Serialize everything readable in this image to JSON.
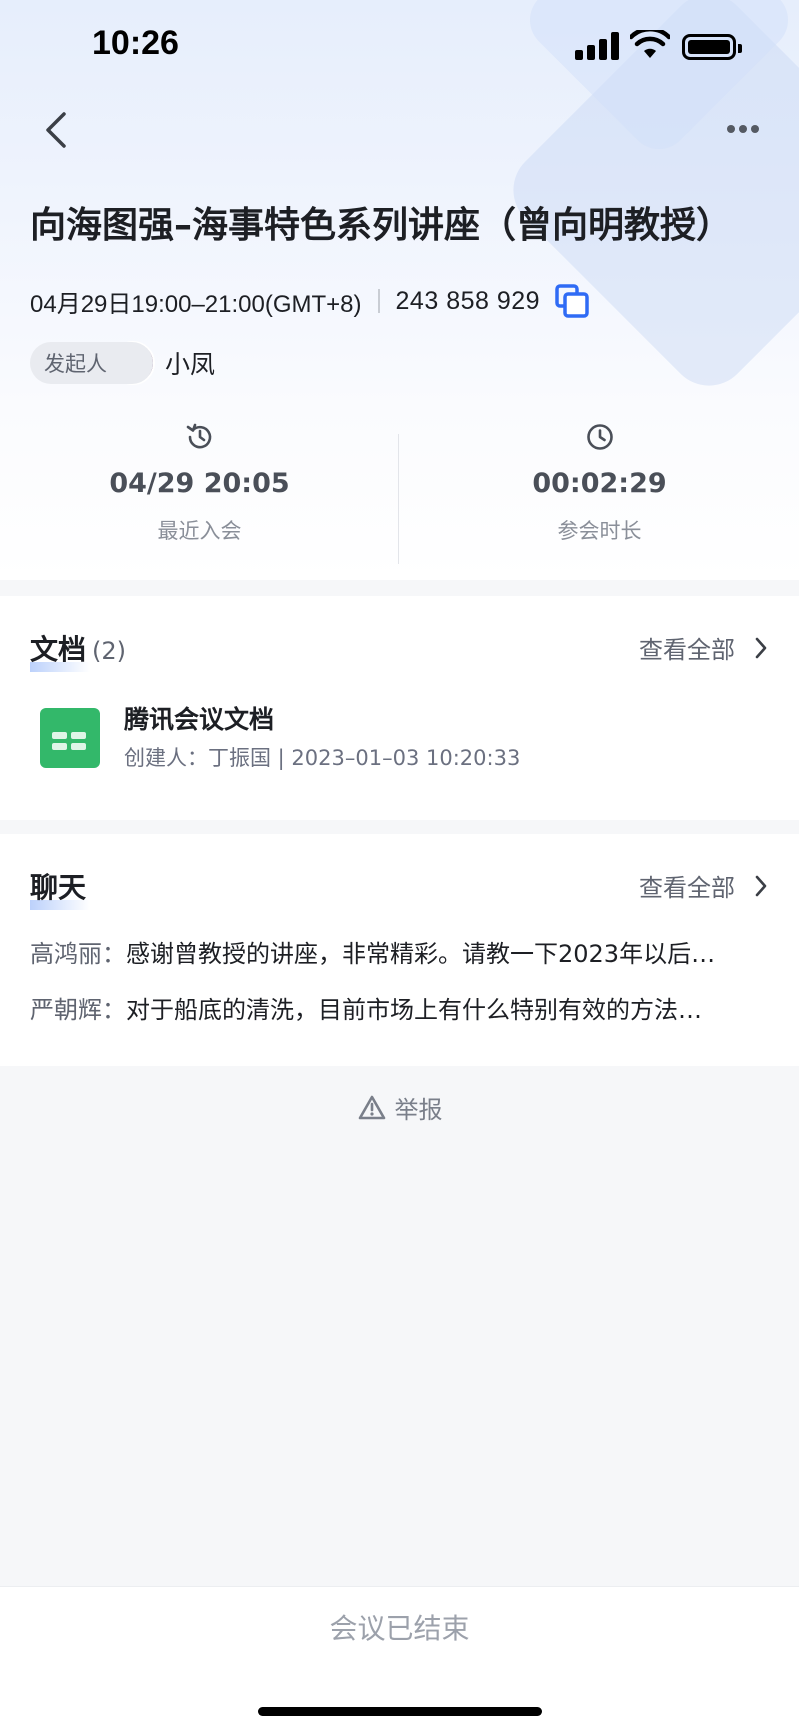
{
  "status_bar": {
    "time": "10:26"
  },
  "meeting": {
    "title": "向海图强–海事特色系列讲座（曾向明教授）",
    "time_range": "04月29日19:00–21:00(GMT+8)",
    "meeting_id": "243 858 929",
    "host_label": "发起人",
    "host_name": "小凤"
  },
  "stats": {
    "last_join": {
      "value": "04/29 20:05",
      "label": "最近入会"
    },
    "duration": {
      "value": "00:02:29",
      "label": "参会时长"
    }
  },
  "documents": {
    "title": "文档",
    "count": "(2)",
    "view_all": "查看全部",
    "items": [
      {
        "name": "腾讯会议文档",
        "meta": "创建人：丁振国 | 2023–01–03 10:20:33"
      }
    ]
  },
  "chat": {
    "title": "聊天",
    "view_all": "查看全部",
    "messages": [
      {
        "sender": "高鸿丽：",
        "text": "感谢曾教授的讲座，非常精彩。请教一下2023年以后…"
      },
      {
        "sender": "严朝辉：",
        "text": "对于船底的清洗，目前市场上有什么特别有效的方法…"
      }
    ]
  },
  "report_label": "举报",
  "footer": {
    "status": "会议已结束"
  },
  "colors": {
    "accent": "#2f6bf5",
    "doc_green": "#33b86a"
  }
}
